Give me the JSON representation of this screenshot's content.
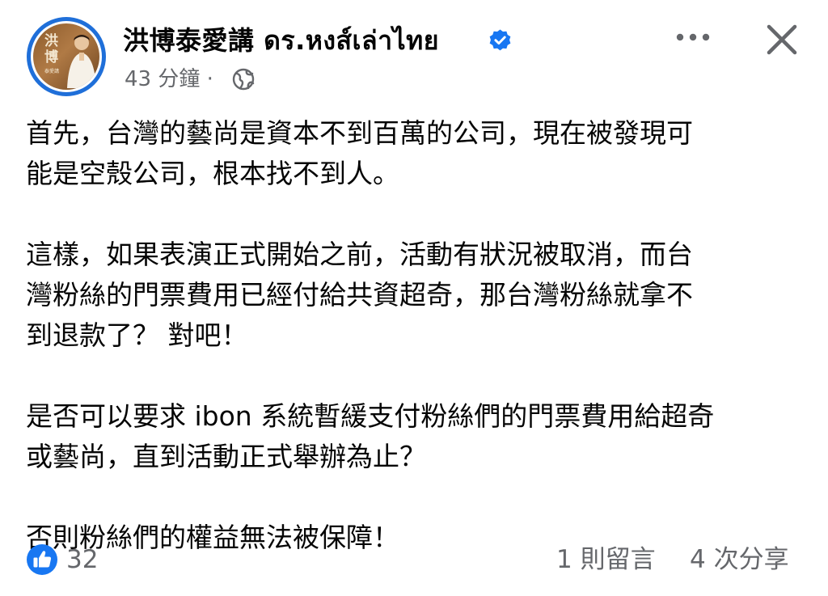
{
  "post": {
    "author": {
      "name": "洪博泰愛講 ดร.หงส์เล่าไทย",
      "verified": true,
      "avatar_text_line1": "洪",
      "avatar_text_line2": "博",
      "avatar_subtext": "泰愛講"
    },
    "meta": {
      "time": "43 分鐘 ·",
      "audience_icon": "globe-icon"
    },
    "actions": {
      "more_icon": "more-horizontal-icon",
      "close_icon": "close-icon"
    },
    "paragraphs": [
      "首先，台灣的藝尚是資本不到百萬的公司，現在被發現可\n能是空殼公司，根本找不到人。",
      "這樣，如果表演正式開始之前，活動有狀況被取消，而台\n灣粉絲的門票費用已經付給共資超奇，那台灣粉絲就拿不\n到退款了？ 對吧！",
      "是否可以要求 ibon 系統暫緩支付粉絲們的門票費用給超奇\n或藝尚，直到活動正式舉辦為止？",
      "否則粉絲們的權益無法被保障！"
    ],
    "footer": {
      "like_count": "32",
      "comments": "1 則留言",
      "shares": "4 次分享"
    }
  },
  "colors": {
    "accent_blue": "#1877f2",
    "secondary_text": "#65676b",
    "primary_text": "#050505"
  }
}
